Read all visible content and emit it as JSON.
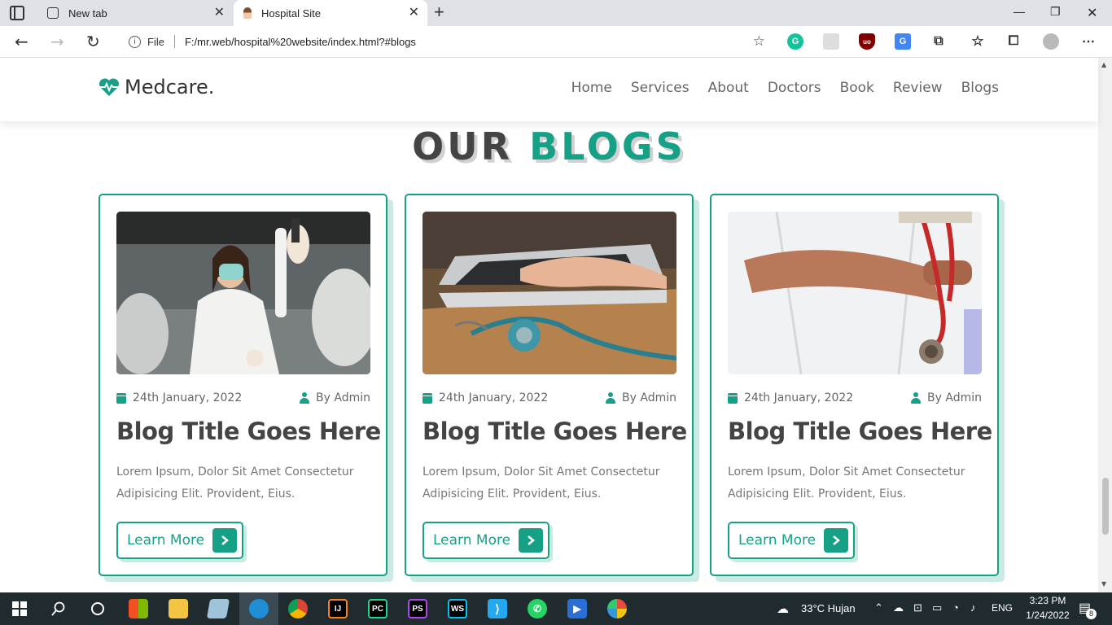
{
  "browser": {
    "tabs": [
      {
        "label": "New tab",
        "active": false
      },
      {
        "label": "Hospital Site",
        "active": true
      }
    ],
    "address": {
      "scheme_label": "File",
      "url": "F:/mr.web/hospital%20website/index.html?#blogs"
    }
  },
  "site": {
    "logo_text": "Medcare.",
    "nav": [
      "Home",
      "Services",
      "About",
      "Doctors",
      "Book",
      "Review",
      "Blogs"
    ],
    "heading": {
      "main": "OUR",
      "accent": "BLOGS"
    },
    "colors": {
      "accent": "#16a085",
      "text": "#444444"
    },
    "blogs": [
      {
        "image": "lab-scientist-photo",
        "date": "24th January, 2022",
        "author": "By Admin",
        "title": "Blog Title Goes Here",
        "description": "Lorem Ipsum, Dolor Sit Amet Consectetur Adipisicing Elit. Provident, Eius.",
        "button": "Learn More"
      },
      {
        "image": "laptop-stethoscope-photo",
        "date": "24th January, 2022",
        "author": "By Admin",
        "title": "Blog Title Goes Here",
        "description": "Lorem Ipsum, Dolor Sit Amet Consectetur Adipisicing Elit. Provident, Eius.",
        "button": "Learn More"
      },
      {
        "image": "doctor-stethoscope-photo",
        "date": "24th January, 2022",
        "author": "By Admin",
        "title": "Blog Title Goes Here",
        "description": "Lorem Ipsum, Dolor Sit Amet Consectetur Adipisicing Elit. Provident, Eius.",
        "button": "Learn More"
      }
    ]
  },
  "taskbar": {
    "weather": "33°C  Hujan",
    "language": "ENG",
    "time": "3:23 PM",
    "date": "1/24/2022",
    "notifications": "8"
  }
}
